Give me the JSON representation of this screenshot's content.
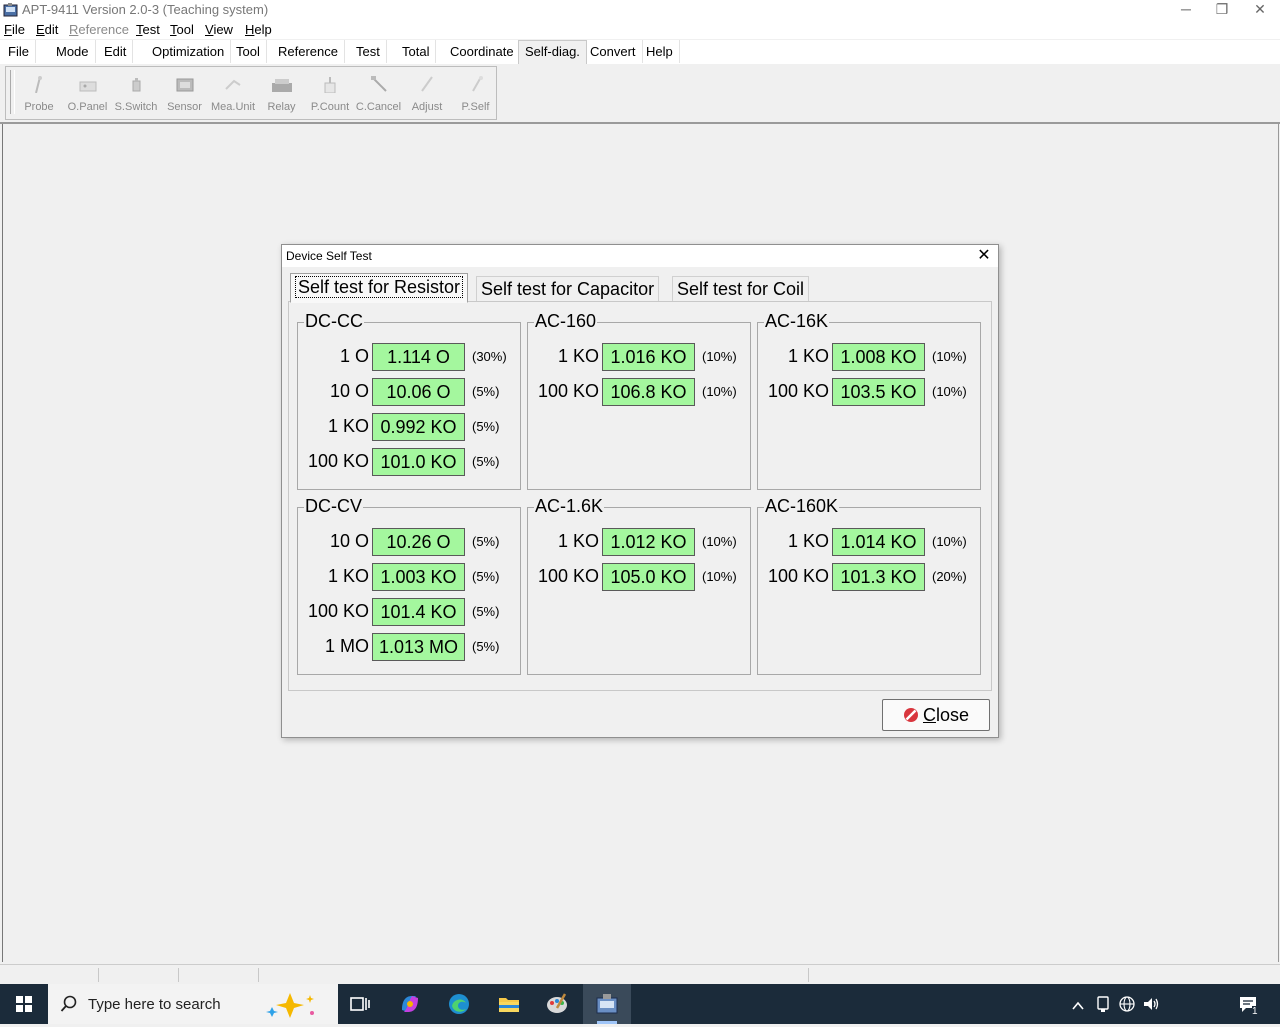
{
  "window": {
    "title": "APT-9411 Version 2.0-3 (Teaching system)",
    "controls": {
      "minimize": "─",
      "restore": "❐",
      "close": "✕"
    }
  },
  "menubar": [
    {
      "label": "File",
      "u": "F",
      "rest": "ile",
      "disabled": false
    },
    {
      "label": "Edit",
      "u": "E",
      "rest": "dit",
      "disabled": false
    },
    {
      "label": "Reference",
      "u": "R",
      "rest": "eference",
      "disabled": true
    },
    {
      "label": "Test",
      "u": "T",
      "rest": "est",
      "disabled": false
    },
    {
      "label": "Tool",
      "u": "T",
      "rest": "ool",
      "disabled": false
    },
    {
      "label": "View",
      "u": "V",
      "rest": "iew",
      "disabled": false
    },
    {
      "label": "Help",
      "u": "H",
      "rest": "elp",
      "disabled": false
    }
  ],
  "ribbon_tabs": [
    "File",
    "Mode",
    "Edit",
    "Optimization",
    "Tool",
    "Reference",
    "Test",
    "Total",
    "Coordinate",
    "Self-diag.",
    "Convert",
    "Help"
  ],
  "ribbon_active": "Self-diag.",
  "toolbar": [
    {
      "label": "Probe",
      "icon": "probe-icon"
    },
    {
      "label": "O.Panel",
      "icon": "panel-icon"
    },
    {
      "label": "S.Switch",
      "icon": "switch-icon"
    },
    {
      "label": "Sensor",
      "icon": "sensor-icon"
    },
    {
      "label": "Mea.Unit",
      "icon": "measure-unit-icon"
    },
    {
      "label": "Relay",
      "icon": "relay-icon"
    },
    {
      "label": "P.Count",
      "icon": "probe-count-icon"
    },
    {
      "label": "C.Cancel",
      "icon": "cancel-icon"
    },
    {
      "label": "Adjust",
      "icon": "adjust-icon"
    },
    {
      "label": "P.Self",
      "icon": "probe-self-icon"
    }
  ],
  "dialog": {
    "title": "Device Self Test",
    "tabs": [
      "Self test for Resistor",
      "Self test for Capacitor",
      "Self test for Coil"
    ],
    "selected_tab": 0,
    "groups": [
      {
        "title": "DC-CC",
        "rows": [
          {
            "label": "1 O",
            "value": "1.114 O",
            "tol": "(30%)"
          },
          {
            "label": "10 O",
            "value": "10.06 O",
            "tol": "(5%)"
          },
          {
            "label": "1 KO",
            "value": "0.992 KO",
            "tol": "(5%)"
          },
          {
            "label": "100 KO",
            "value": "101.0 KO",
            "tol": "(5%)"
          }
        ]
      },
      {
        "title": "AC-160",
        "rows": [
          {
            "label": "1 KO",
            "value": "1.016 KO",
            "tol": "(10%)"
          },
          {
            "label": "100 KO",
            "value": "106.8 KO",
            "tol": "(10%)"
          }
        ]
      },
      {
        "title": "AC-16K",
        "rows": [
          {
            "label": "1 KO",
            "value": "1.008 KO",
            "tol": "(10%)"
          },
          {
            "label": "100 KO",
            "value": "103.5 KO",
            "tol": "(10%)"
          }
        ]
      },
      {
        "title": "DC-CV",
        "rows": [
          {
            "label": "10 O",
            "value": "10.26 O",
            "tol": "(5%)"
          },
          {
            "label": "1 KO",
            "value": "1.003 KO",
            "tol": "(5%)"
          },
          {
            "label": "100 KO",
            "value": "101.4 KO",
            "tol": "(5%)"
          },
          {
            "label": "1 MO",
            "value": "1.013 MO",
            "tol": "(5%)"
          }
        ]
      },
      {
        "title": "AC-1.6K",
        "rows": [
          {
            "label": "1 KO",
            "value": "1.012 KO",
            "tol": "(10%)"
          },
          {
            "label": "100 KO",
            "value": "105.0 KO",
            "tol": "(10%)"
          }
        ]
      },
      {
        "title": "AC-160K",
        "rows": [
          {
            "label": "1 KO",
            "value": "1.014 KO",
            "tol": "(10%)"
          },
          {
            "label": "100 KO",
            "value": "101.3 KO",
            "tol": "(20%)"
          }
        ]
      }
    ],
    "close_button": {
      "label": "Close",
      "u": "C",
      "rest": "lose"
    }
  },
  "taskbar": {
    "search_placeholder": "Type here to search",
    "notification_count": "1"
  },
  "colors": {
    "value_bg": "#a4f79e",
    "taskbar": "#1b2b3a"
  }
}
